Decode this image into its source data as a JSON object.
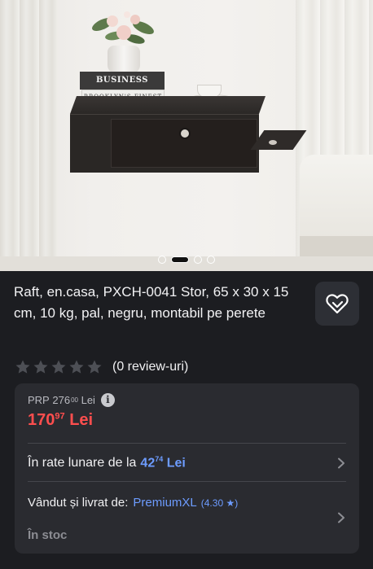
{
  "gallery": {
    "book_top_label": "BUSINESS",
    "book_bottom_label": "BROOKLYN'S FINEST",
    "slide_count": 4,
    "active_slide": 2
  },
  "product": {
    "title": "Raft, en.casa, PXCH-0041 Stor, 65 x 30 x 15 cm, 10 kg, pal, negru, montabil pe perete",
    "rating_stars": 0,
    "review_text": "(0 review-uri)"
  },
  "pricing": {
    "prp_label": "PRP",
    "prp_int": "276",
    "prp_dec": "00",
    "prp_currency": "Lei",
    "info_glyph": "i",
    "price_int": "170",
    "price_dec": "97",
    "price_currency": "Lei"
  },
  "installments": {
    "text": "În rate lunare de la",
    "amount_int": "42",
    "amount_dec": "74",
    "currency": "Lei"
  },
  "seller": {
    "label": "Vândut și livrat de:",
    "name": "PremiumXL",
    "score": "(4.30 ★)",
    "stock": "În stoc"
  },
  "colors": {
    "background": "#1c1d21",
    "card": "#2a2b30",
    "price_red": "#ff4e4e",
    "link_blue": "#6d9cff"
  },
  "icons": [
    "heart-icon",
    "star-icon",
    "info-icon",
    "chevron-right-icon"
  ]
}
